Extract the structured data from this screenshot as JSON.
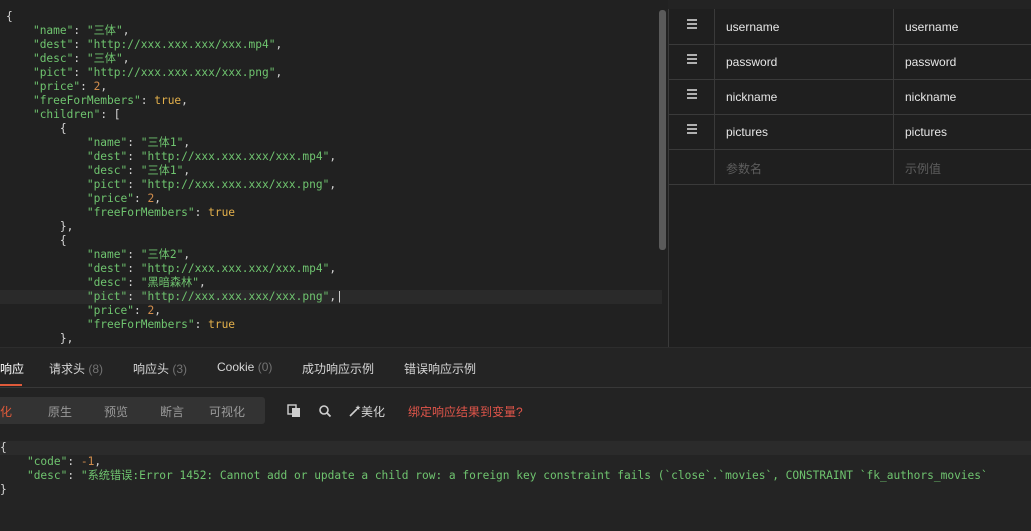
{
  "editor": {
    "lines": [
      {
        "indent": "",
        "parts": [
          {
            "t": "{",
            "c": "p"
          }
        ]
      },
      {
        "indent": "    ",
        "parts": [
          {
            "t": "\"name\"",
            "c": "k"
          },
          {
            "t": ": ",
            "c": "p"
          },
          {
            "t": "\"三体\"",
            "c": "s"
          },
          {
            "t": ",",
            "c": "p"
          }
        ]
      },
      {
        "indent": "    ",
        "parts": [
          {
            "t": "\"dest\"",
            "c": "k"
          },
          {
            "t": ": ",
            "c": "p"
          },
          {
            "t": "\"http://xxx.xxx.xxx/xxx.mp4\"",
            "c": "s"
          },
          {
            "t": ",",
            "c": "p"
          }
        ]
      },
      {
        "indent": "    ",
        "parts": [
          {
            "t": "\"desc\"",
            "c": "k"
          },
          {
            "t": ": ",
            "c": "p"
          },
          {
            "t": "\"三体\"",
            "c": "s"
          },
          {
            "t": ",",
            "c": "p"
          }
        ]
      },
      {
        "indent": "    ",
        "parts": [
          {
            "t": "\"pict\"",
            "c": "k"
          },
          {
            "t": ": ",
            "c": "p"
          },
          {
            "t": "\"http://xxx.xxx.xxx/xxx.png\"",
            "c": "s"
          },
          {
            "t": ",",
            "c": "p"
          }
        ]
      },
      {
        "indent": "    ",
        "parts": [
          {
            "t": "\"price\"",
            "c": "k"
          },
          {
            "t": ": ",
            "c": "p"
          },
          {
            "t": "2",
            "c": "n"
          },
          {
            "t": ",",
            "c": "p"
          }
        ]
      },
      {
        "indent": "    ",
        "parts": [
          {
            "t": "\"freeForMembers\"",
            "c": "k"
          },
          {
            "t": ": ",
            "c": "p"
          },
          {
            "t": "true",
            "c": "b"
          },
          {
            "t": ",",
            "c": "p"
          }
        ]
      },
      {
        "indent": "    ",
        "parts": [
          {
            "t": "\"children\"",
            "c": "k"
          },
          {
            "t": ": [",
            "c": "p"
          }
        ]
      },
      {
        "indent": "        ",
        "parts": [
          {
            "t": "{",
            "c": "p"
          }
        ]
      },
      {
        "indent": "            ",
        "parts": [
          {
            "t": "\"name\"",
            "c": "k"
          },
          {
            "t": ": ",
            "c": "p"
          },
          {
            "t": "\"三体1\"",
            "c": "s"
          },
          {
            "t": ",",
            "c": "p"
          }
        ]
      },
      {
        "indent": "            ",
        "parts": [
          {
            "t": "\"dest\"",
            "c": "k"
          },
          {
            "t": ": ",
            "c": "p"
          },
          {
            "t": "\"http://xxx.xxx.xxx/xxx.mp4\"",
            "c": "s"
          },
          {
            "t": ",",
            "c": "p"
          }
        ]
      },
      {
        "indent": "            ",
        "parts": [
          {
            "t": "\"desc\"",
            "c": "k"
          },
          {
            "t": ": ",
            "c": "p"
          },
          {
            "t": "\"三体1\"",
            "c": "s"
          },
          {
            "t": ",",
            "c": "p"
          }
        ]
      },
      {
        "indent": "            ",
        "parts": [
          {
            "t": "\"pict\"",
            "c": "k"
          },
          {
            "t": ": ",
            "c": "p"
          },
          {
            "t": "\"http://xxx.xxx.xxx/xxx.png\"",
            "c": "s"
          },
          {
            "t": ",",
            "c": "p"
          }
        ]
      },
      {
        "indent": "            ",
        "parts": [
          {
            "t": "\"price\"",
            "c": "k"
          },
          {
            "t": ": ",
            "c": "p"
          },
          {
            "t": "2",
            "c": "n"
          },
          {
            "t": ",",
            "c": "p"
          }
        ]
      },
      {
        "indent": "            ",
        "parts": [
          {
            "t": "\"freeForMembers\"",
            "c": "k"
          },
          {
            "t": ": ",
            "c": "p"
          },
          {
            "t": "true",
            "c": "b"
          }
        ]
      },
      {
        "indent": "        ",
        "parts": [
          {
            "t": "},",
            "c": "p"
          }
        ]
      },
      {
        "indent": "        ",
        "parts": [
          {
            "t": "{",
            "c": "p"
          }
        ]
      },
      {
        "indent": "            ",
        "parts": [
          {
            "t": "\"name\"",
            "c": "k"
          },
          {
            "t": ": ",
            "c": "p"
          },
          {
            "t": "\"三体2\"",
            "c": "s"
          },
          {
            "t": ",",
            "c": "p"
          }
        ]
      },
      {
        "indent": "            ",
        "parts": [
          {
            "t": "\"dest\"",
            "c": "k"
          },
          {
            "t": ": ",
            "c": "p"
          },
          {
            "t": "\"http://xxx.xxx.xxx/xxx.mp4\"",
            "c": "s"
          },
          {
            "t": ",",
            "c": "p"
          }
        ]
      },
      {
        "indent": "            ",
        "parts": [
          {
            "t": "\"desc\"",
            "c": "k"
          },
          {
            "t": ": ",
            "c": "p"
          },
          {
            "t": "\"黑暗森林\"",
            "c": "s"
          },
          {
            "t": ",",
            "c": "p"
          }
        ]
      },
      {
        "indent": "            ",
        "parts": [
          {
            "t": "\"pict\"",
            "c": "k"
          },
          {
            "t": ": ",
            "c": "p"
          },
          {
            "t": "\"http://xxx.xxx.xxx/xxx.png\"",
            "c": "s"
          },
          {
            "t": ",|",
            "c": "p"
          }
        ],
        "active": true
      },
      {
        "indent": "            ",
        "parts": [
          {
            "t": "\"price\"",
            "c": "k"
          },
          {
            "t": ": ",
            "c": "p"
          },
          {
            "t": "2",
            "c": "n"
          },
          {
            "t": ",",
            "c": "p"
          }
        ]
      },
      {
        "indent": "            ",
        "parts": [
          {
            "t": "\"freeForMembers\"",
            "c": "k"
          },
          {
            "t": ": ",
            "c": "p"
          },
          {
            "t": "true",
            "c": "b"
          }
        ]
      },
      {
        "indent": "        ",
        "parts": [
          {
            "t": "},",
            "c": "p"
          }
        ]
      }
    ]
  },
  "params": {
    "rows": [
      {
        "name": "username",
        "example": "username"
      },
      {
        "name": "password",
        "example": "password"
      },
      {
        "name": "nickname",
        "example": "nickname"
      },
      {
        "name": "pictures",
        "example": "pictures"
      }
    ],
    "name_placeholder": "参数名",
    "example_placeholder": "示例值"
  },
  "tabs": {
    "response": "响应",
    "request_headers": "请求头",
    "request_headers_count": "(8)",
    "response_headers": "响应头",
    "response_headers_count": "(3)",
    "cookie": "Cookie",
    "cookie_count": "(0)",
    "success_example": "成功响应示例",
    "error_example": "错误响应示例"
  },
  "toolbar": {
    "pretty": "美化",
    "raw": "原生",
    "preview": "预览",
    "assert": "断言",
    "visualize": "可视化",
    "beautify": "美化",
    "bind_link": "绑定响应结果到变量?"
  },
  "response": {
    "lines": [
      {
        "indent": "",
        "parts": [
          {
            "t": "{",
            "c": "p"
          }
        ]
      },
      {
        "indent": "    ",
        "parts": [
          {
            "t": "\"code\"",
            "c": "k"
          },
          {
            "t": ": ",
            "c": "p"
          },
          {
            "t": "-1",
            "c": "n"
          },
          {
            "t": ",",
            "c": "p"
          }
        ]
      },
      {
        "indent": "    ",
        "parts": [
          {
            "t": "\"desc\"",
            "c": "k"
          },
          {
            "t": ": ",
            "c": "p"
          },
          {
            "t": "\"系统错误:Error 1452: Cannot add or update a child row: a foreign key constraint fails (`close`.`movies`, CONSTRAINT `fk_authors_movies`",
            "c": "s"
          }
        ]
      },
      {
        "indent": "",
        "parts": [
          {
            "t": "}",
            "c": "p"
          }
        ]
      }
    ]
  }
}
